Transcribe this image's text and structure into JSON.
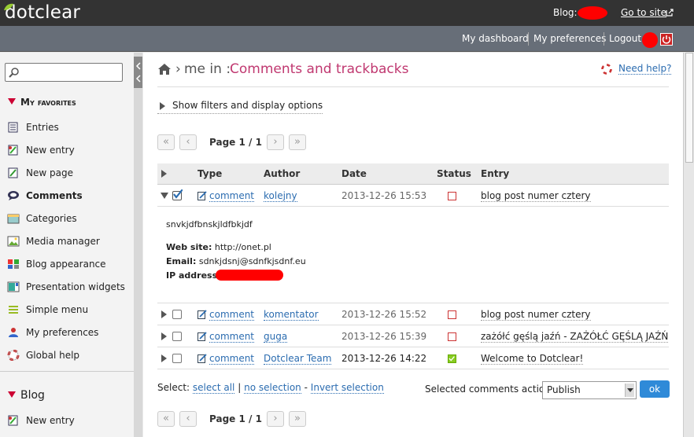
{
  "header": {
    "logo": "dotclear",
    "blog_label": "Blog:",
    "goto_site": "Go to site"
  },
  "subbar": {
    "dashboard": "My dashboard",
    "preferences": "My preferences",
    "logout": "Logout"
  },
  "sidebar": {
    "favorites_title": "My favorites",
    "items": [
      {
        "label": "Entries",
        "icon": "entries-icon"
      },
      {
        "label": "New entry",
        "icon": "new-entry-icon"
      },
      {
        "label": "New page",
        "icon": "new-page-icon"
      },
      {
        "label": "Comments",
        "icon": "comments-icon"
      },
      {
        "label": "Categories",
        "icon": "categories-icon"
      },
      {
        "label": "Media manager",
        "icon": "media-icon"
      },
      {
        "label": "Blog appearance",
        "icon": "appearance-icon"
      },
      {
        "label": "Presentation widgets",
        "icon": "widgets-icon"
      },
      {
        "label": "Simple menu",
        "icon": "menu-icon"
      },
      {
        "label": "My preferences",
        "icon": "user-prefs-icon"
      },
      {
        "label": "Global help",
        "icon": "help-icon"
      }
    ],
    "blog_title": "Blog",
    "blog_items": [
      {
        "label": "New entry",
        "icon": "new-entry-icon"
      }
    ]
  },
  "main": {
    "crumb_sep": "›",
    "crumb_blog": "me in :",
    "title": "Comments and trackbacks",
    "help": "Need help?",
    "filters": "Show filters and display options",
    "pager": {
      "first": "«",
      "prev": "‹",
      "label": "Page 1 / 1",
      "next": "›",
      "last": "»"
    },
    "columns": [
      "Type",
      "Author",
      "Date",
      "Status",
      "Entry"
    ],
    "rows": [
      {
        "type": "comment",
        "author": "kolejny",
        "date": "2013-12-26 15:53",
        "status": "pending",
        "entry": "blog post numer cztery",
        "checked": true,
        "expanded": true
      },
      {
        "type": "comment",
        "author": "komentator",
        "date": "2013-12-26 15:52",
        "status": "pending",
        "entry": "blog post numer cztery",
        "checked": false,
        "expanded": false
      },
      {
        "type": "comment",
        "author": "guga",
        "date": "2013-12-26 15:39",
        "status": "pending",
        "entry": "zażółć gęślą jaźń - ZAŻÓŁĆ GĘŚLĄ JAŹŃ",
        "checked": false,
        "expanded": false
      },
      {
        "type": "comment",
        "author": "Dotclear Team",
        "date": "2013-12-26 14:22",
        "status": "published",
        "entry": "Welcome to Dotclear!",
        "checked": false,
        "expanded": false
      }
    ],
    "detail": {
      "content": "snvkjdfbnskjldfbkjdf",
      "website_label": "Web site:",
      "website": "http://onet.pl",
      "email_label": "Email:",
      "email": "sdnkjdsnj@sdnfkjsdnf.eu",
      "ip_label": "IP address:"
    },
    "select": {
      "label": "Select:",
      "all": "select all",
      "none": "no selection",
      "invert": "Invert selection",
      "dash": "-",
      "bar": "|"
    },
    "action_label": "Selected comments action:",
    "action_value": "Publish",
    "ok": "ok"
  },
  "colors": {
    "accent": "#c03870",
    "link": "#2b6cb0",
    "header": "#333333",
    "subbar": "#676e78",
    "ok_button": "#2f8ad8"
  }
}
